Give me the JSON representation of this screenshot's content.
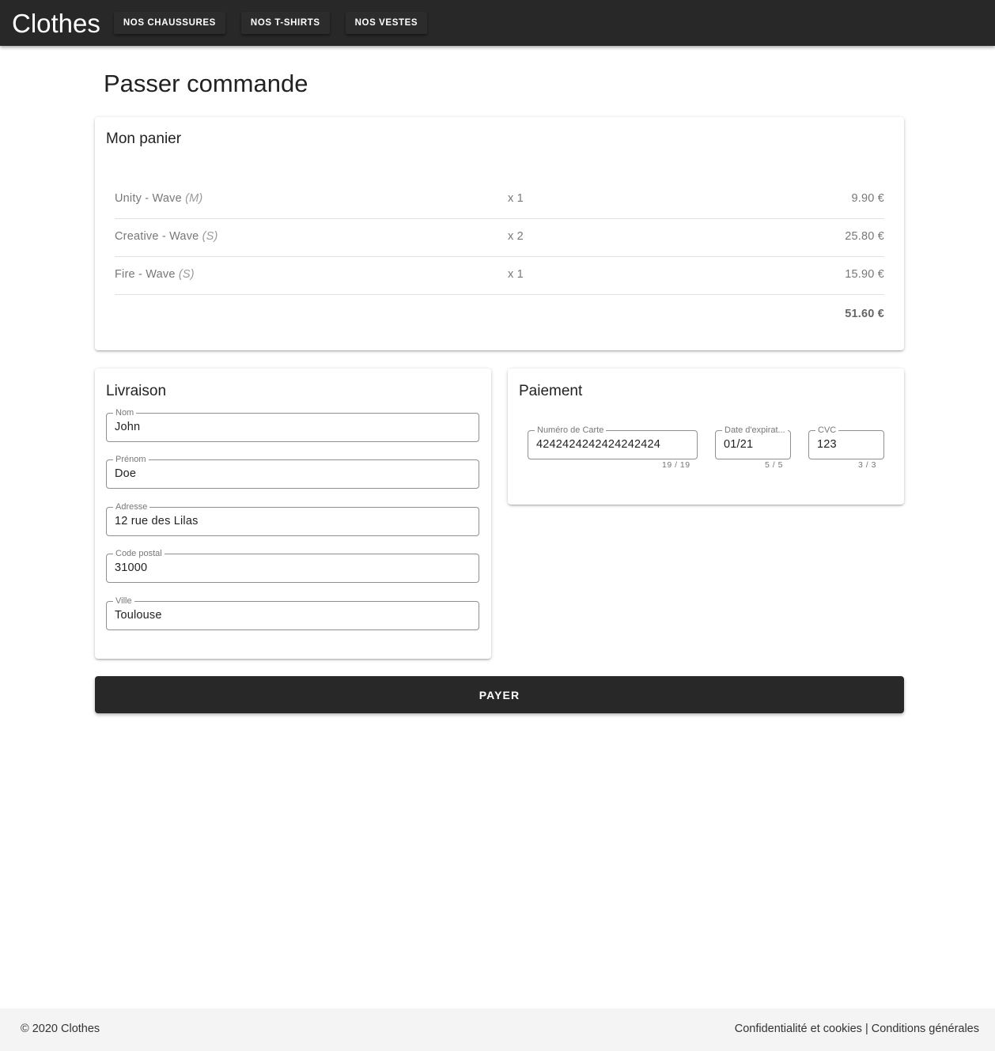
{
  "header": {
    "brand": "Clothes",
    "nav": [
      "NOS CHAUSSURES",
      "NOS T-SHIRTS",
      "NOS VESTES"
    ]
  },
  "page": {
    "title": "Passer commande"
  },
  "cart": {
    "title": "Mon panier",
    "items": [
      {
        "name": "Unity - Wave",
        "size": "(M)",
        "qty": "x 1",
        "price": "9.90 €"
      },
      {
        "name": "Creative - Wave",
        "size": "(S)",
        "qty": "x 2",
        "price": "25.80 €"
      },
      {
        "name": "Fire - Wave",
        "size": "(S)",
        "qty": "x 1",
        "price": "15.90 €"
      }
    ],
    "total": "51.60 €"
  },
  "delivery": {
    "title": "Livraison",
    "fields": [
      {
        "label": "Nom",
        "value": "John"
      },
      {
        "label": "Prénom",
        "value": "Doe"
      },
      {
        "label": "Adresse",
        "value": "12 rue des Lilas"
      },
      {
        "label": "Code postal",
        "value": "31000"
      },
      {
        "label": "Ville",
        "value": "Toulouse"
      }
    ]
  },
  "payment": {
    "title": "Paiement",
    "card_number": {
      "label": "Numéro de Carte",
      "value": "4242424242424242424",
      "counter": "19 / 19"
    },
    "expiry": {
      "label": "Date d'expirat...",
      "value": "01/21",
      "counter": "5 / 5"
    },
    "cvc": {
      "label": "CVC",
      "value": "123",
      "counter": "3 / 3"
    }
  },
  "actions": {
    "pay_label": "PAYER"
  },
  "footer": {
    "copyright": "© 2020 Clothes",
    "privacy_link": "Confidentialité et cookies",
    "separator": " | ",
    "terms_link": "Conditions générales"
  },
  "colors": {
    "appbar": "#282828",
    "button": "#282828",
    "footer_bg": "#f4f4f4",
    "border": "#909090"
  }
}
